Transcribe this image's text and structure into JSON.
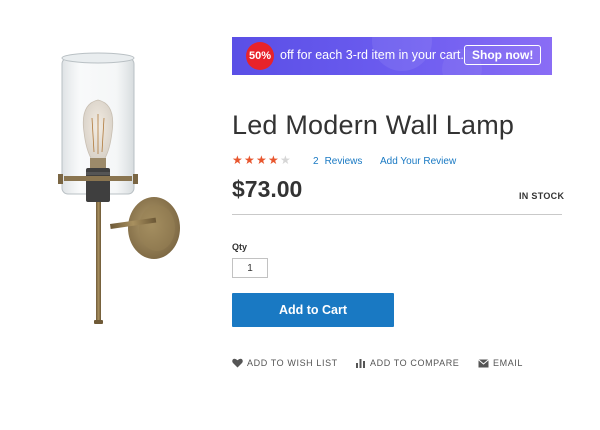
{
  "promo": {
    "badge": "50%",
    "text": "off for each 3-rd item in your cart.",
    "button_label": "Shop now!"
  },
  "product": {
    "title": "Led Modern Wall Lamp",
    "rating_stars": 4,
    "rating_max": 5,
    "review_count": "2",
    "reviews_label": "Reviews",
    "add_review_label": "Add Your Review",
    "price": "$73.00",
    "stock_status": "IN STOCK",
    "qty_label": "Qty",
    "qty_value": "1",
    "add_to_cart_label": "Add to Cart"
  },
  "actions": {
    "wish_list": "ADD TO WISH LIST",
    "compare": "ADD TO COMPARE",
    "email": "EMAIL"
  },
  "colors": {
    "primary": "#1979c3",
    "star": "#e8562e",
    "promo_bg": "#6d5df0",
    "promo_badge": "#e8232a"
  }
}
